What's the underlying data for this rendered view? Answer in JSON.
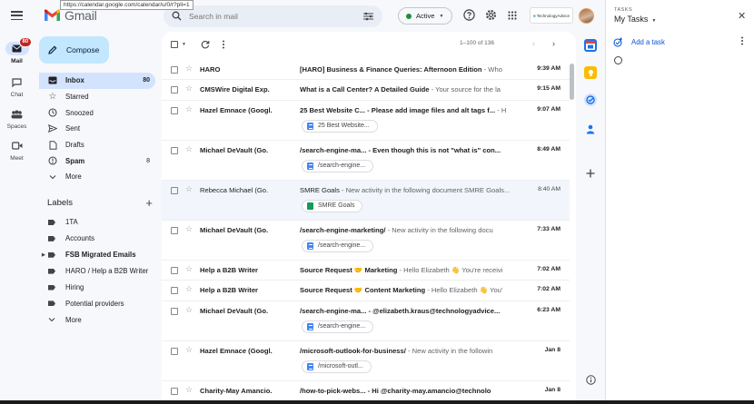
{
  "tooltip_url": "https://calendar.google.com/calendar/u/0/r?pli=1",
  "app": {
    "name": "Gmail"
  },
  "rail": [
    {
      "label": "Mail",
      "badge": "80",
      "icon": "mail-icon"
    },
    {
      "label": "Chat",
      "icon": "chat-icon"
    },
    {
      "label": "Spaces",
      "icon": "spaces-icon"
    },
    {
      "label": "Meet",
      "icon": "meet-icon"
    }
  ],
  "search": {
    "placeholder": "Search in mail"
  },
  "status": {
    "label": "Active",
    "color": "#1e8e3e"
  },
  "brand": {
    "text": "TechnologyAdvice"
  },
  "compose": {
    "label": "Compose"
  },
  "nav": [
    {
      "label": "Inbox",
      "count": "80",
      "icon": "inbox-icon"
    },
    {
      "label": "Starred",
      "count": "",
      "icon": "star-icon"
    },
    {
      "label": "Snoozed",
      "count": "",
      "icon": "clock-icon"
    },
    {
      "label": "Sent",
      "count": "",
      "icon": "send-icon"
    },
    {
      "label": "Drafts",
      "count": "",
      "icon": "draft-icon"
    },
    {
      "label": "Spam",
      "count": "8",
      "icon": "spam-icon"
    },
    {
      "label": "More",
      "count": "",
      "icon": "chevron-down-icon"
    }
  ],
  "labels": {
    "title": "Labels",
    "items": [
      {
        "label": "1TA"
      },
      {
        "label": "Accounts"
      },
      {
        "label": "FSB Migrated Emails"
      },
      {
        "label": "HARO / Help a B2B Writer"
      },
      {
        "label": "Hiring"
      },
      {
        "label": "Potential providers"
      },
      {
        "label": "More"
      }
    ]
  },
  "toolbar": {
    "pagination": "1–100 of 136"
  },
  "emails": [
    {
      "sender": "HARO",
      "subject": "[HARO] Business & Finance Queries: Afternoon Edition",
      "snippet": " - Who",
      "date": "9:39 AM",
      "chip": ""
    },
    {
      "sender": "CMSWire Digital Exp.",
      "subject": "What is a Call Center? A Detailed Guide",
      "snippet": " - Your source for the la",
      "date": "9:15 AM",
      "chip": ""
    },
    {
      "sender": "Hazel Emnace (Googl.",
      "subject": "25 Best Website C... - Please add image files and alt tags f...",
      "snippet": " - H",
      "date": "9:07 AM",
      "chip": "25 Best Website..."
    },
    {
      "sender": "Michael DeVault (Go.",
      "subject": "/search-engine-ma... - Even though this is not \"what is\" con...",
      "snippet": "",
      "date": "8:49 AM",
      "chip": "/search-engine..."
    },
    {
      "sender": "Rebecca Michael (Go.",
      "subject": "SMRE Goals",
      "snippet": " - New activity in the following document SMRE Goals...",
      "date": "8:40 AM",
      "chip": "SMRE Goals"
    },
    {
      "sender": "Michael DeVault (Go.",
      "subject": "/search-engine-marketing/",
      "snippet": " - New activity in the following docu",
      "date": "7:33 AM",
      "chip": "/search-engine..."
    },
    {
      "sender": "Help a B2B Writer",
      "subject": "Source Request 🤝 Marketing",
      "snippet": " - Hello Elizabeth 👋 You're receivi",
      "date": "7:02 AM",
      "chip": ""
    },
    {
      "sender": "Help a B2B Writer",
      "subject": "Source Request 🤝 Content Marketing",
      "snippet": " - Hello Elizabeth 👋 You'",
      "date": "7:02 AM",
      "chip": ""
    },
    {
      "sender": "Michael DeVault (Go.",
      "subject": "/search-engine-ma... - @elizabeth.kraus@technologyadvice...",
      "snippet": "",
      "date": "6:23 AM",
      "chip": "/search-engine..."
    },
    {
      "sender": "Hazel Emnace (Googl.",
      "subject": "/microsoft-outlook-for-business/",
      "snippet": " - New activity in the followin",
      "date": "Jan 8",
      "chip": "/microsoft-outl..."
    },
    {
      "sender": "Charity-May Amancio.",
      "subject": "/how-to-pick-webs... - Hi @charity-may.amancio@technolo",
      "snippet": "",
      "date": "Jan 8",
      "chip": ""
    }
  ],
  "tasks": {
    "section": "TASKS",
    "title": "My Tasks",
    "add_label": "Add a task"
  }
}
